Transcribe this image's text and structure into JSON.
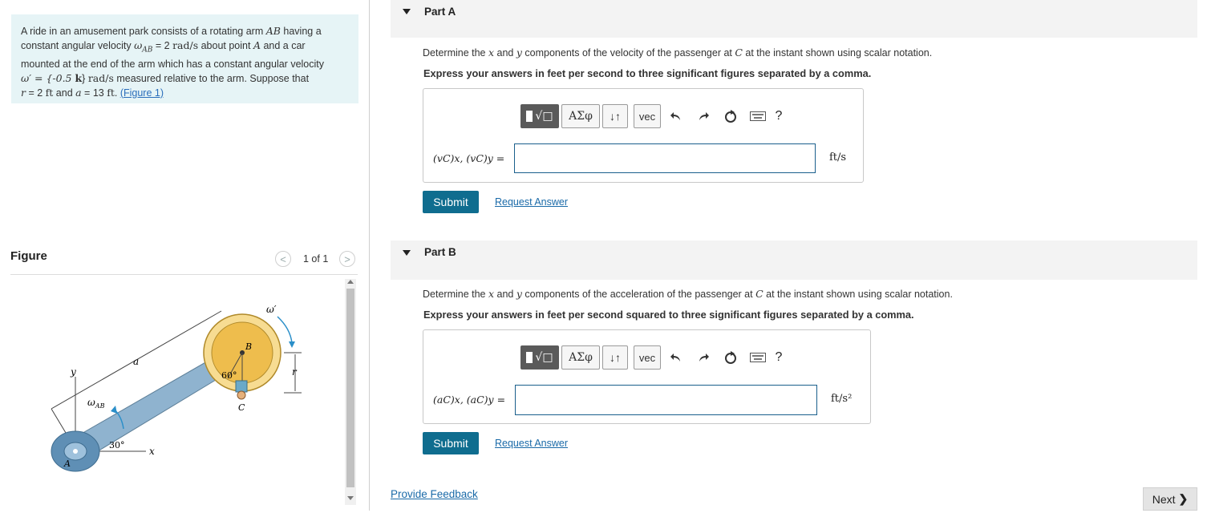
{
  "problem": {
    "line1_a": "A ride in an amusement park consists of a rotating arm ",
    "arm": "AB",
    "line1_b": " having a",
    "line2_a": "constant angular velocity ",
    "omega_ab": "ω",
    "omega_ab_sub": "AB",
    "line2_b": " = 2 ",
    "unit_rad": "rad/s",
    "line2_c": " about point ",
    "point_a": "A",
    "line2_d": " and a car",
    "line3": "mounted at the end of the arm which has a constant angular velocity",
    "line4_a": "ω′ = {-0.5 ",
    "k": "k",
    "line4_b": "} ",
    "line4_c": " measured relative to the arm. Suppose that",
    "line5_a": "r",
    "line5_b": " = 2 ",
    "ft": "ft",
    "line5_c": " and ",
    "a": "a",
    "line5_d": " = 13 ",
    "line5_e": ". ",
    "figure_link": "(Figure 1)"
  },
  "figure": {
    "title": "Figure",
    "pager": "1 of 1",
    "labels": {
      "y": "y",
      "x": "x",
      "a": "a",
      "r": "r",
      "b": "B",
      "c": "C",
      "A": "A",
      "omega_prime": "ω′",
      "omega_ab": "ω",
      "omega_ab_sub": "AB",
      "angle30": "30°",
      "angle60": "60°"
    }
  },
  "partA": {
    "title": "Part A",
    "question_a": "Determine the ",
    "x": "x",
    "and": " and ",
    "y": "y",
    "question_b": " components of the velocity of the passenger at ",
    "c": "C",
    "question_c": " at the instant shown using scalar notation.",
    "instruction": "Express your answers in feet per second to three significant figures separated by a comma.",
    "label": "(v",
    "label_full": "(vC)x, (vC)y =",
    "unit": "ft/s",
    "submit": "Submit",
    "request": "Request Answer"
  },
  "partB": {
    "title": "Part B",
    "question_a": "Determine the ",
    "x": "x",
    "and": " and ",
    "y": "y",
    "question_b": " components of the acceleration of the passenger at ",
    "c": "C",
    "question_c": " at the instant shown using scalar notation.",
    "instruction": "Express your answers in feet per second squared to three significant figures separated by a comma.",
    "label_full": "(aC)x, (aC)y =",
    "unit": "ft/s²",
    "submit": "Submit",
    "request": "Request Answer"
  },
  "toolbar": {
    "greek": "ΑΣφ",
    "arrows": "↓↑",
    "vec": "vec",
    "help": "?"
  },
  "footer": {
    "feedback": "Provide Feedback",
    "next": "Next"
  }
}
